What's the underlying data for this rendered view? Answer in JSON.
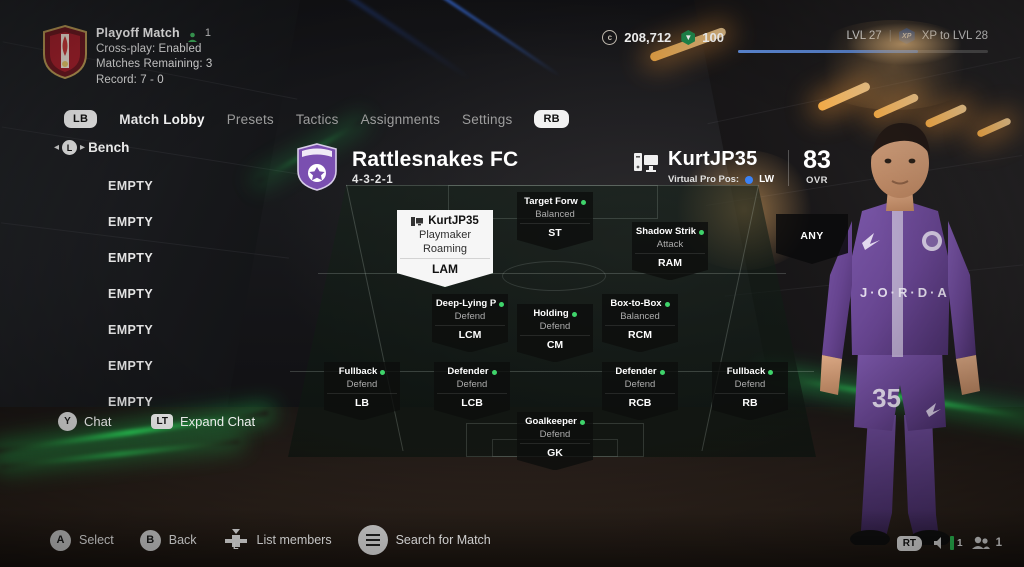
{
  "header": {
    "crest_icon": "club-crest-red-shield",
    "match_title": "Playoff Match",
    "players_icon": "people-icon",
    "players_count": "1",
    "crossplay": "Cross-play: Enabled",
    "matches_remaining": "Matches Remaining: 3",
    "record": "Record: 7 - 0",
    "coins_icon": "coin-icon",
    "coins": "208,712",
    "points_icon": "points-gem-icon",
    "points": "100",
    "level_current": "LVL 27",
    "xp_badge_icon": "xp-badge-icon",
    "xp_to_next": "XP to LVL 28",
    "xp_progress_percent": 72
  },
  "nav": {
    "left_bumper": "LB",
    "right_bumper": "RB",
    "tabs": [
      {
        "label": "Match Lobby",
        "active": true
      },
      {
        "label": "Presets",
        "active": false
      },
      {
        "label": "Tactics",
        "active": false
      },
      {
        "label": "Assignments",
        "active": false
      },
      {
        "label": "Settings",
        "active": false
      }
    ]
  },
  "bench": {
    "stick_icon": "left-stick-icon",
    "title": "Bench",
    "slots": [
      "EMPTY",
      "EMPTY",
      "EMPTY",
      "EMPTY",
      "EMPTY",
      "EMPTY",
      "EMPTY"
    ]
  },
  "chat": {
    "chat_button": "Y",
    "chat_label": "Chat",
    "expand_button": "LT",
    "expand_label": "Expand Chat"
  },
  "team": {
    "crest_icon": "rattlesnakes-crest-icon",
    "name": "Rattlesnakes FC",
    "formation": "4-3-2-1"
  },
  "pro": {
    "platform_icon": "pc-icon",
    "name": "KurtJP35",
    "position_label": "Virtual Pro Pos:",
    "position_dot_color": "#3b82f6",
    "position": "LW",
    "ovr_value": "83",
    "ovr_label": "OVR"
  },
  "pitch": {
    "any_slot_label": "ANY",
    "selected_card": {
      "platform_icon": "pc-icon",
      "name": "KurtJP35",
      "role": "Playmaker",
      "focus": "Roaming",
      "position": "LAM",
      "badges": [
        "c-badge-icon",
        "dot-badge-icon"
      ]
    },
    "positions": [
      {
        "role": "Target Forw",
        "focus": "Balanced",
        "position": "ST",
        "dot": "#3fd46b"
      },
      {
        "role": "Shadow Strik",
        "focus": "Attack",
        "position": "RAM",
        "dot": "#3fd46b"
      },
      {
        "role": "Deep-Lying P",
        "focus": "Defend",
        "position": "LCM",
        "dot": "#3fd46b"
      },
      {
        "role": "Holding",
        "focus": "Defend",
        "position": "CM",
        "dot": "#3fd46b"
      },
      {
        "role": "Box-to-Box",
        "focus": "Balanced",
        "position": "RCM",
        "dot": "#3fd46b"
      },
      {
        "role": "Fullback",
        "focus": "Defend",
        "position": "LB",
        "dot": "#3fd46b"
      },
      {
        "role": "Defender",
        "focus": "Defend",
        "position": "LCB",
        "dot": "#3fd46b"
      },
      {
        "role": "Defender",
        "focus": "Defend",
        "position": "RCB",
        "dot": "#3fd46b"
      },
      {
        "role": "Fullback",
        "focus": "Defend",
        "position": "RB",
        "dot": "#3fd46b"
      },
      {
        "role": "Goalkeeper",
        "focus": "Defend",
        "position": "GK",
        "dot": "#3fd46b"
      }
    ]
  },
  "player_render": {
    "kit_brand": "JORDAN",
    "kit_number": "35",
    "kit_color": "#6b4a96"
  },
  "footer": {
    "actions": [
      {
        "button": "A",
        "label": "Select",
        "icon": "a-button-icon"
      },
      {
        "button": "B",
        "label": "Back",
        "icon": "b-button-icon"
      },
      {
        "button": "L",
        "label": "List members",
        "icon": "dpad-left-icon"
      },
      {
        "button": "",
        "label": "Search for Match",
        "icon": "menu-button-icon"
      }
    ],
    "right_trigger": "RT",
    "voice_icon": "speaker-icon",
    "voice_value": "1",
    "party_icon": "people-icon",
    "party_count": "1"
  }
}
